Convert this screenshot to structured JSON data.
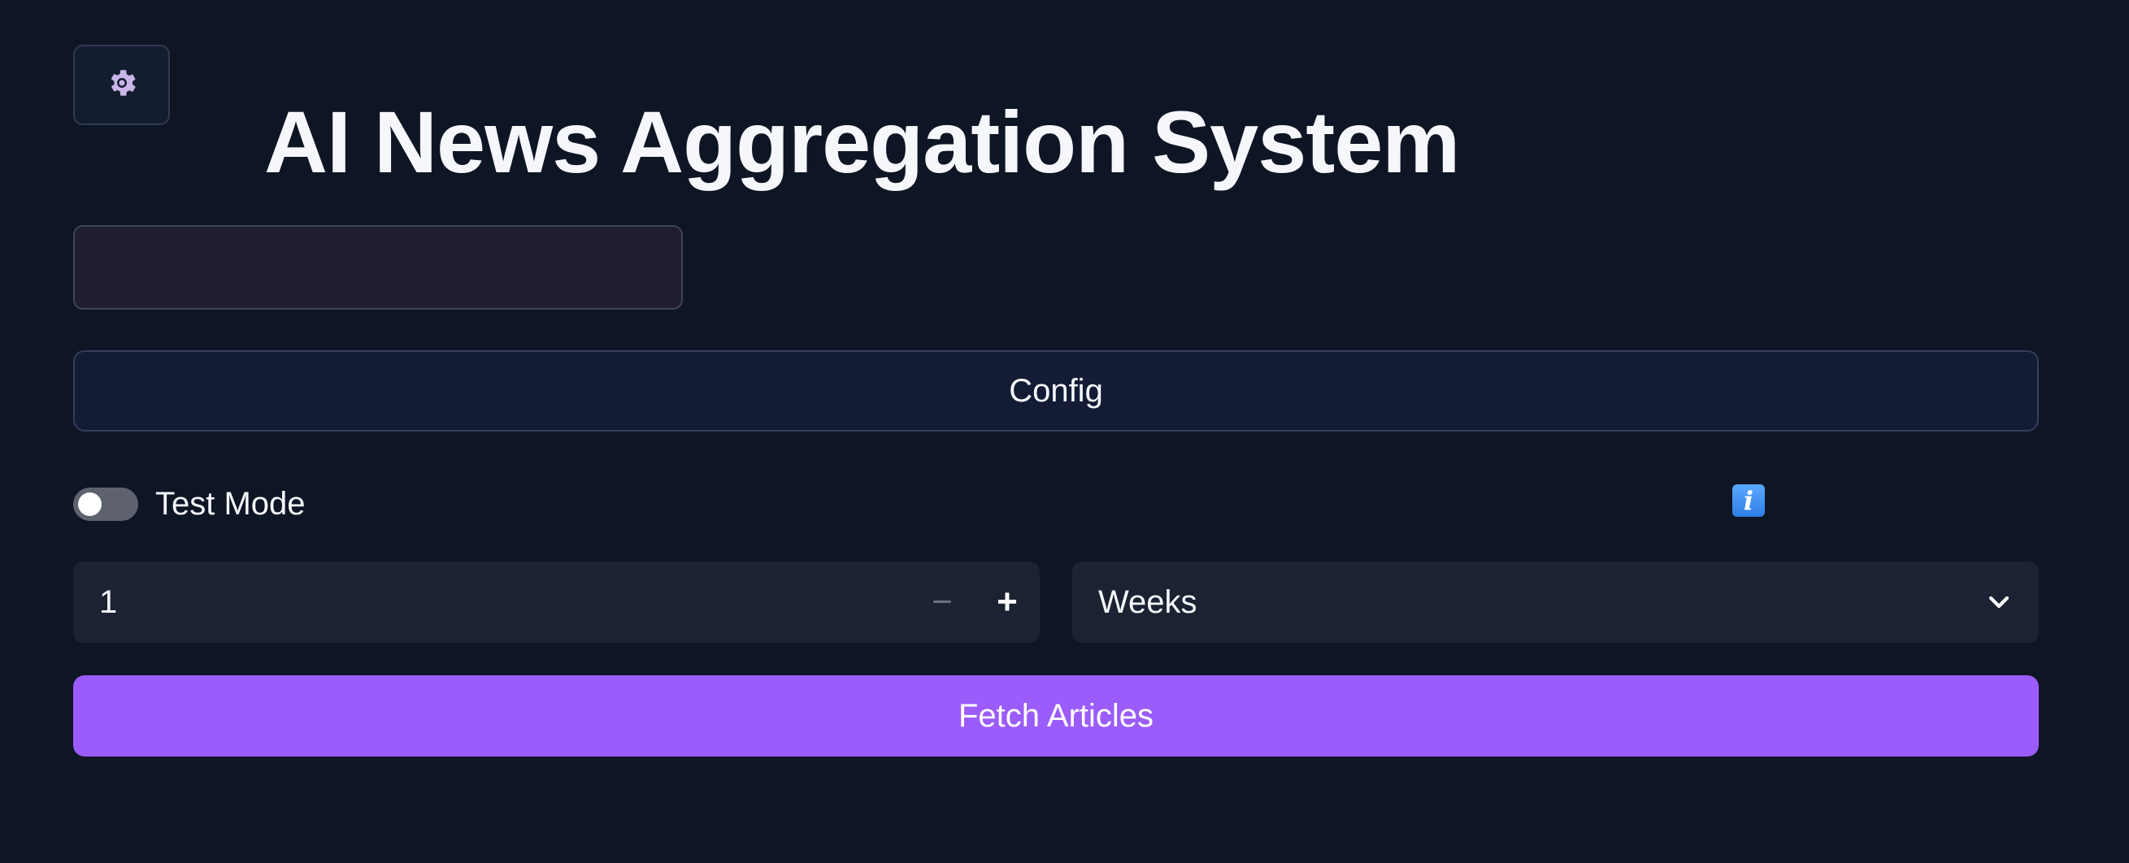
{
  "header": {
    "title": "AI News Aggregation System",
    "settings_icon": "gear-icon"
  },
  "search": {
    "value": "",
    "placeholder": ""
  },
  "config_button": {
    "label": "Config"
  },
  "test_mode": {
    "label": "Test Mode",
    "enabled": false
  },
  "info_icon": {
    "name": "info-icon",
    "glyph": "i"
  },
  "period": {
    "amount": "1",
    "minus": "−",
    "plus": "+",
    "unit": "Weeks"
  },
  "fetch_button": {
    "label": "Fetch Articles"
  },
  "colors": {
    "background": "#0e1525",
    "accent": "#9b5cfb",
    "info": "#3b8df0"
  }
}
